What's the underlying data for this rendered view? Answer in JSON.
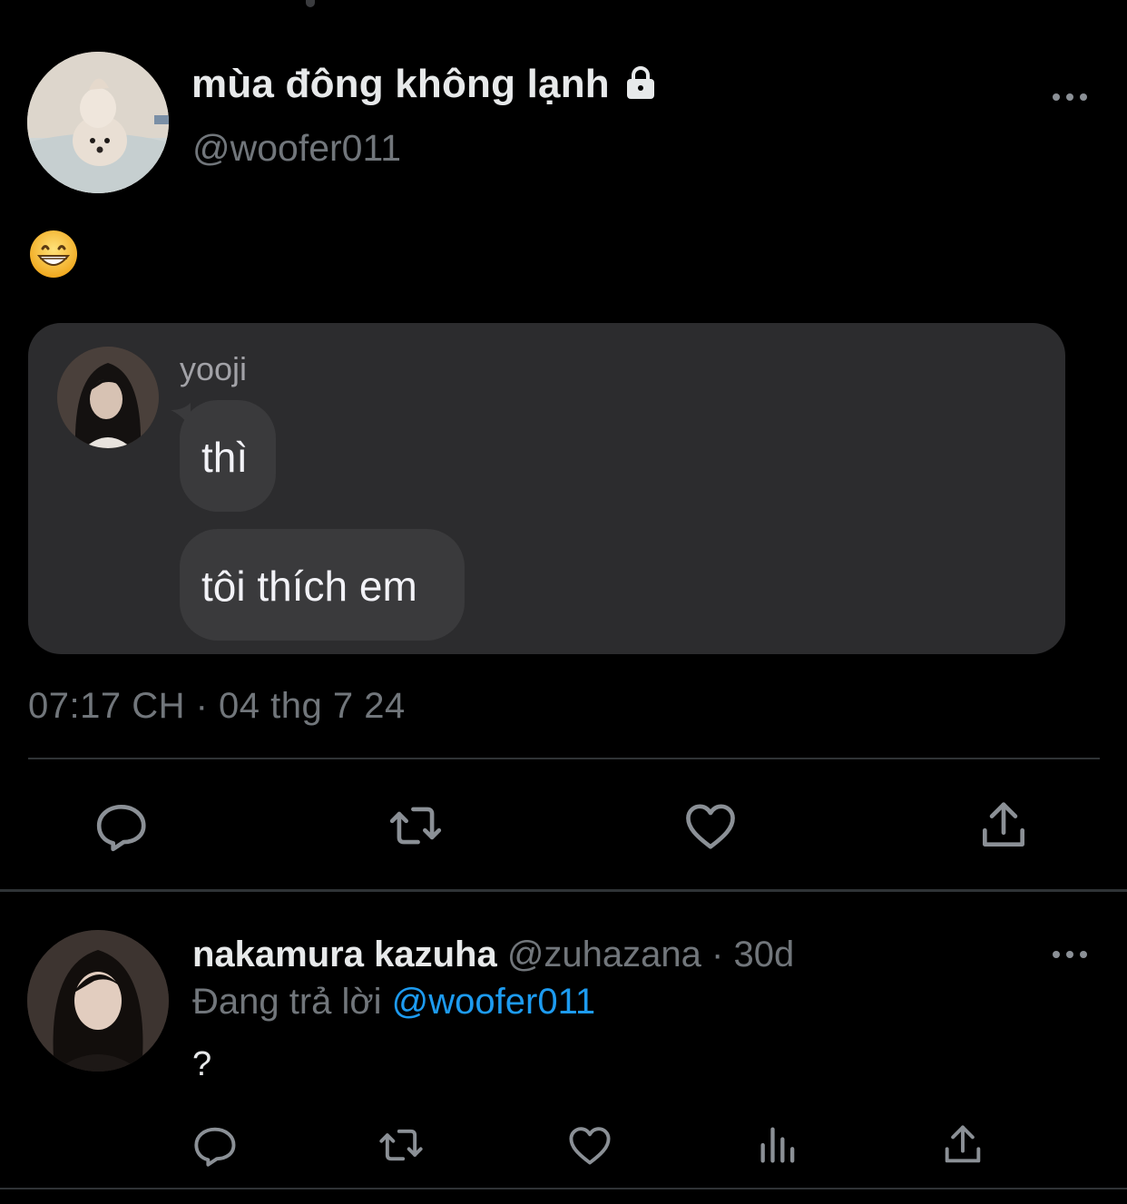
{
  "main_tweet": {
    "display_name": "mùa đông không lạnh",
    "handle": "@woofer011",
    "protected_icon": "lock-icon",
    "body_emoji": "😁",
    "timestamp": "07:17 CH · 04 thg 7 24",
    "attachment": {
      "sender": "yooji",
      "messages": [
        "thì",
        "tôi thích em"
      ]
    },
    "actions": [
      "reply-icon",
      "retweet-icon",
      "like-icon",
      "share-icon"
    ]
  },
  "reply_tweet": {
    "display_name": "nakamura kazuha",
    "handle": "@zuhazana",
    "separator": "·",
    "age": "30d",
    "replying_prefix": "Đang trả lời",
    "replying_to": "@woofer011",
    "text": "?",
    "actions": [
      "reply-icon",
      "retweet-icon",
      "like-icon",
      "views-icon",
      "share-icon"
    ]
  },
  "colors": {
    "background": "#000000",
    "primary_text": "#e7e9ea",
    "secondary_text": "#71767b",
    "link": "#1d9bf0",
    "card": "#2c2c2e",
    "bubble": "#3a3a3c"
  }
}
